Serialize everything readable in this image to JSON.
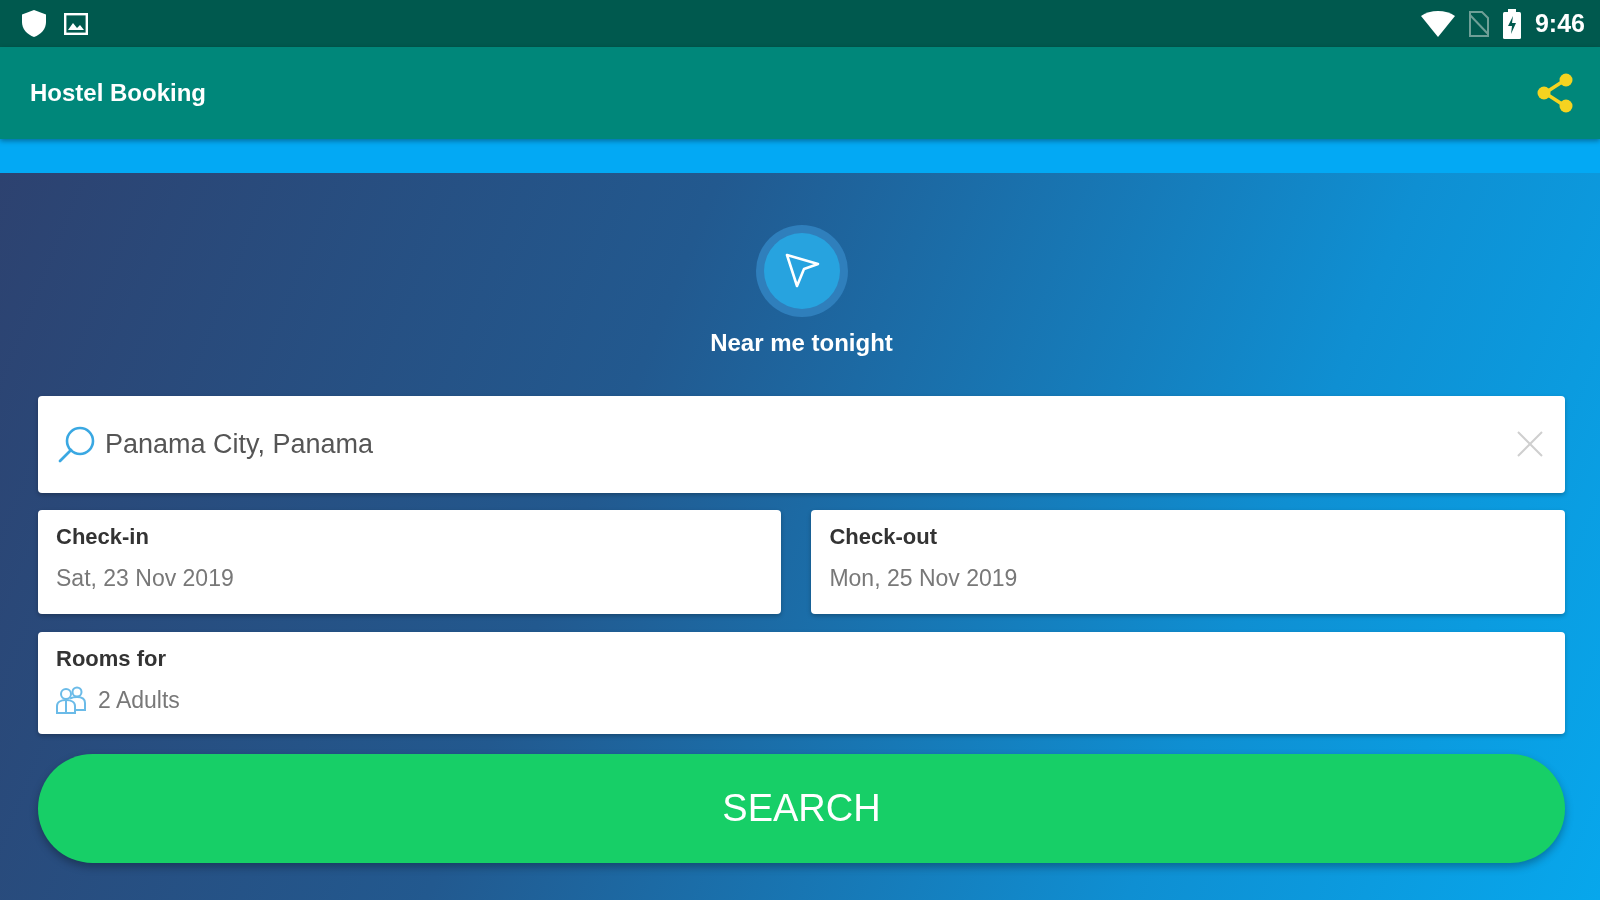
{
  "status_bar": {
    "time": "9:46"
  },
  "app_bar": {
    "title": "Hostel Booking"
  },
  "near_me": {
    "label": "Near me tonight"
  },
  "search": {
    "value": "Panama City, Panama"
  },
  "dates": [
    {
      "label": "Check-in",
      "value": "Sat, 23 Nov 2019"
    },
    {
      "label": "Check-out",
      "value": "Mon, 25 Nov 2019"
    }
  ],
  "rooms": {
    "label": "Rooms for",
    "value": "2 Adults"
  },
  "search_button": {
    "label": "SEARCH"
  }
}
